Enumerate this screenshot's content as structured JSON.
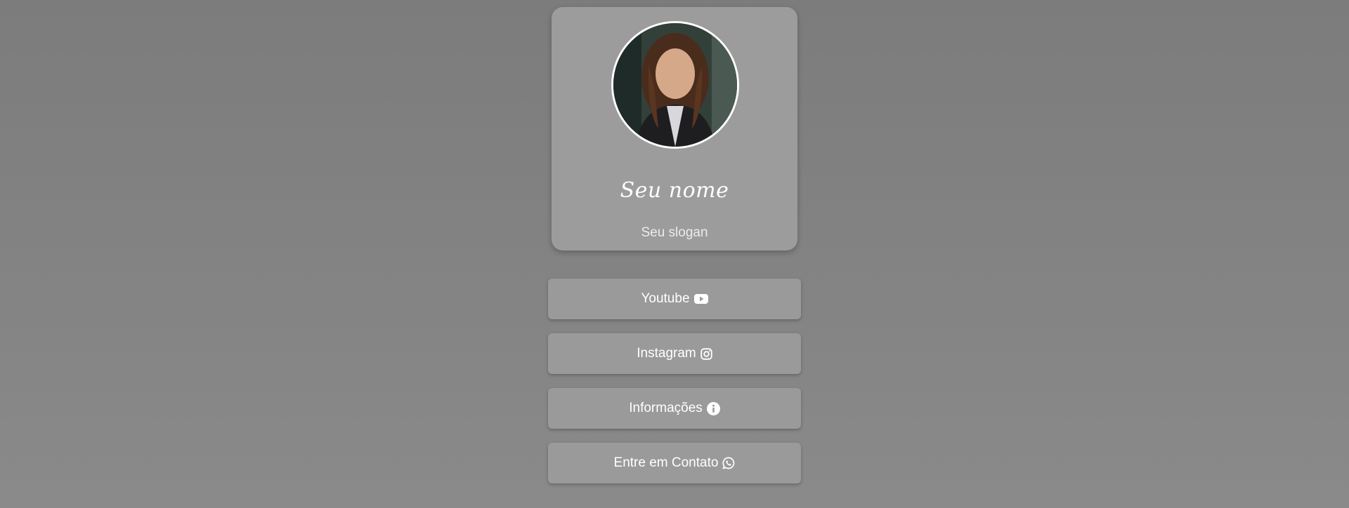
{
  "profile": {
    "name": "Seu nome",
    "slogan": "Seu slogan"
  },
  "links": [
    {
      "label": "Youtube",
      "icon": "youtube-icon"
    },
    {
      "label": "Instagram",
      "icon": "instagram-icon"
    },
    {
      "label": "Informações",
      "icon": "info-circle-icon"
    },
    {
      "label": "Entre em Contato",
      "icon": "whatsapp-icon"
    }
  ],
  "colors": {
    "background": "#808080",
    "card": "#9c9c9c",
    "button": "#9a9a9a",
    "text": "#ffffff"
  }
}
